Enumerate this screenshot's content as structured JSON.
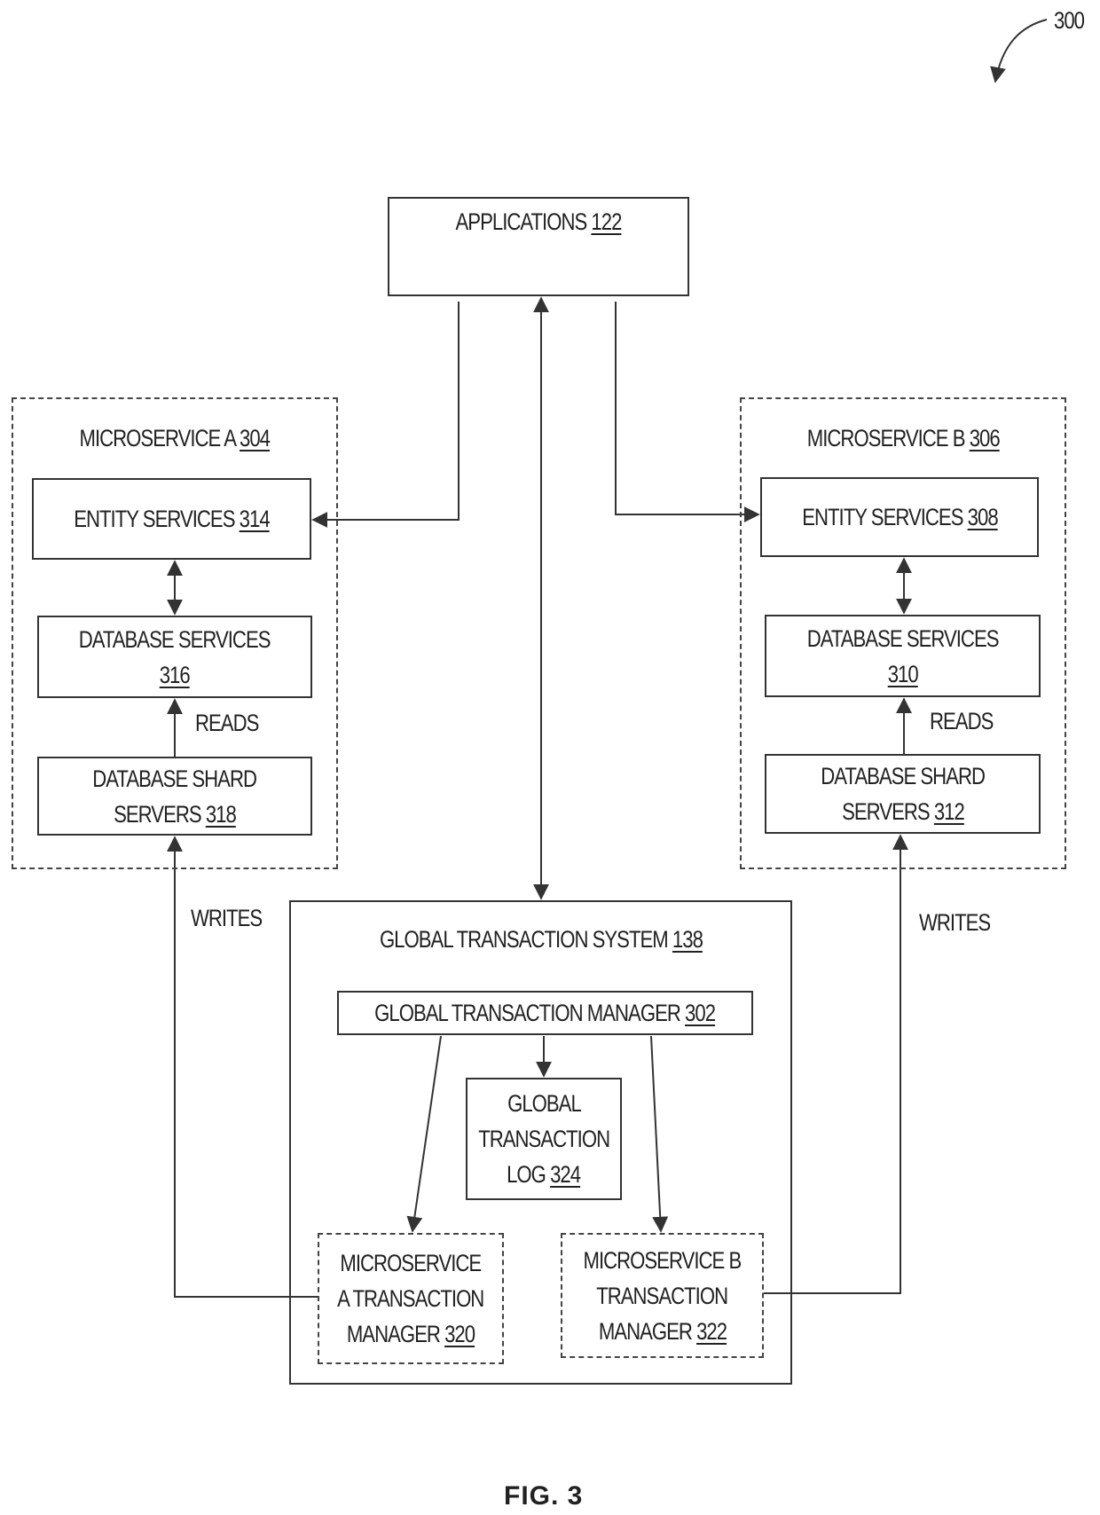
{
  "figure": {
    "label": "FIG. 3",
    "reference_number": "300"
  },
  "applications": {
    "title": "APPLICATIONS",
    "ref": "122"
  },
  "microservice_a": {
    "title": "MICROSERVICE A",
    "ref": "304",
    "entity_services": {
      "title": "ENTITY SERVICES",
      "ref": "314"
    },
    "database_services": {
      "title": "DATABASE SERVICES",
      "ref": "316"
    },
    "database_shard_servers": {
      "title_line1": "DATABASE SHARD",
      "title_line2": "SERVERS",
      "ref": "318"
    },
    "reads_label": "READS"
  },
  "microservice_b": {
    "title": "MICROSERVICE B",
    "ref": "306",
    "entity_services": {
      "title": "ENTITY SERVICES",
      "ref": "308"
    },
    "database_services": {
      "title": "DATABASE SERVICES",
      "ref": "310"
    },
    "database_shard_servers": {
      "title_line1": "DATABASE SHARD",
      "title_line2": "SERVERS",
      "ref": "312"
    },
    "reads_label": "READS"
  },
  "global_transaction_system": {
    "title": "GLOBAL TRANSACTION SYSTEM",
    "ref": "138",
    "manager": {
      "title": "GLOBAL TRANSACTION MANAGER",
      "ref": "302"
    },
    "log": {
      "line1": "GLOBAL",
      "line2": "TRANSACTION",
      "line3": "LOG",
      "ref": "324"
    },
    "ms_a_tm": {
      "line1": "MICROSERVICE",
      "line2": "A TRANSACTION",
      "line3": "MANAGER",
      "ref": "320"
    },
    "ms_b_tm": {
      "line1": "MICROSERVICE B",
      "line2": "TRANSACTION",
      "line3": "MANAGER",
      "ref": "322"
    }
  },
  "writes_left_label": "WRITES",
  "writes_right_label": "WRITES"
}
